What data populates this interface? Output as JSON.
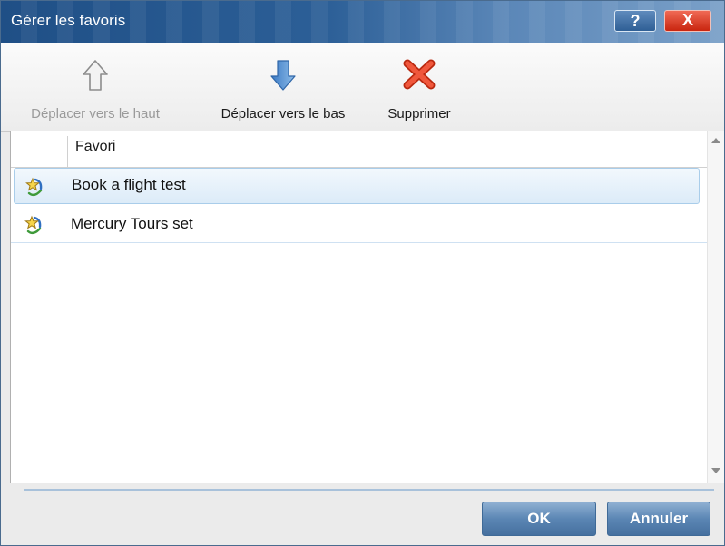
{
  "window": {
    "title": "Gérer les favoris",
    "help_label": "?",
    "close_label": "X"
  },
  "toolbar": {
    "move_up": {
      "label": "Déplacer vers le haut",
      "icon": "arrow-up-icon",
      "enabled": false
    },
    "move_down": {
      "label": "Déplacer vers le bas",
      "icon": "arrow-down-icon",
      "enabled": true
    },
    "delete": {
      "label": "Supprimer",
      "icon": "delete-x-icon",
      "enabled": true
    }
  },
  "grid": {
    "column_header": "Favori",
    "rows": [
      {
        "label": "Book a flight test",
        "icon": "favorite-star-icon",
        "selected": true
      },
      {
        "label": "Mercury Tours set",
        "icon": "favorite-star-icon",
        "selected": false
      }
    ]
  },
  "footer": {
    "ok_label": "OK",
    "cancel_label": "Annuler"
  },
  "colors": {
    "titlebar": "#2c5f97",
    "close_button": "#d8341c",
    "selection": "#dcebf8",
    "button": "#5b86b4"
  }
}
